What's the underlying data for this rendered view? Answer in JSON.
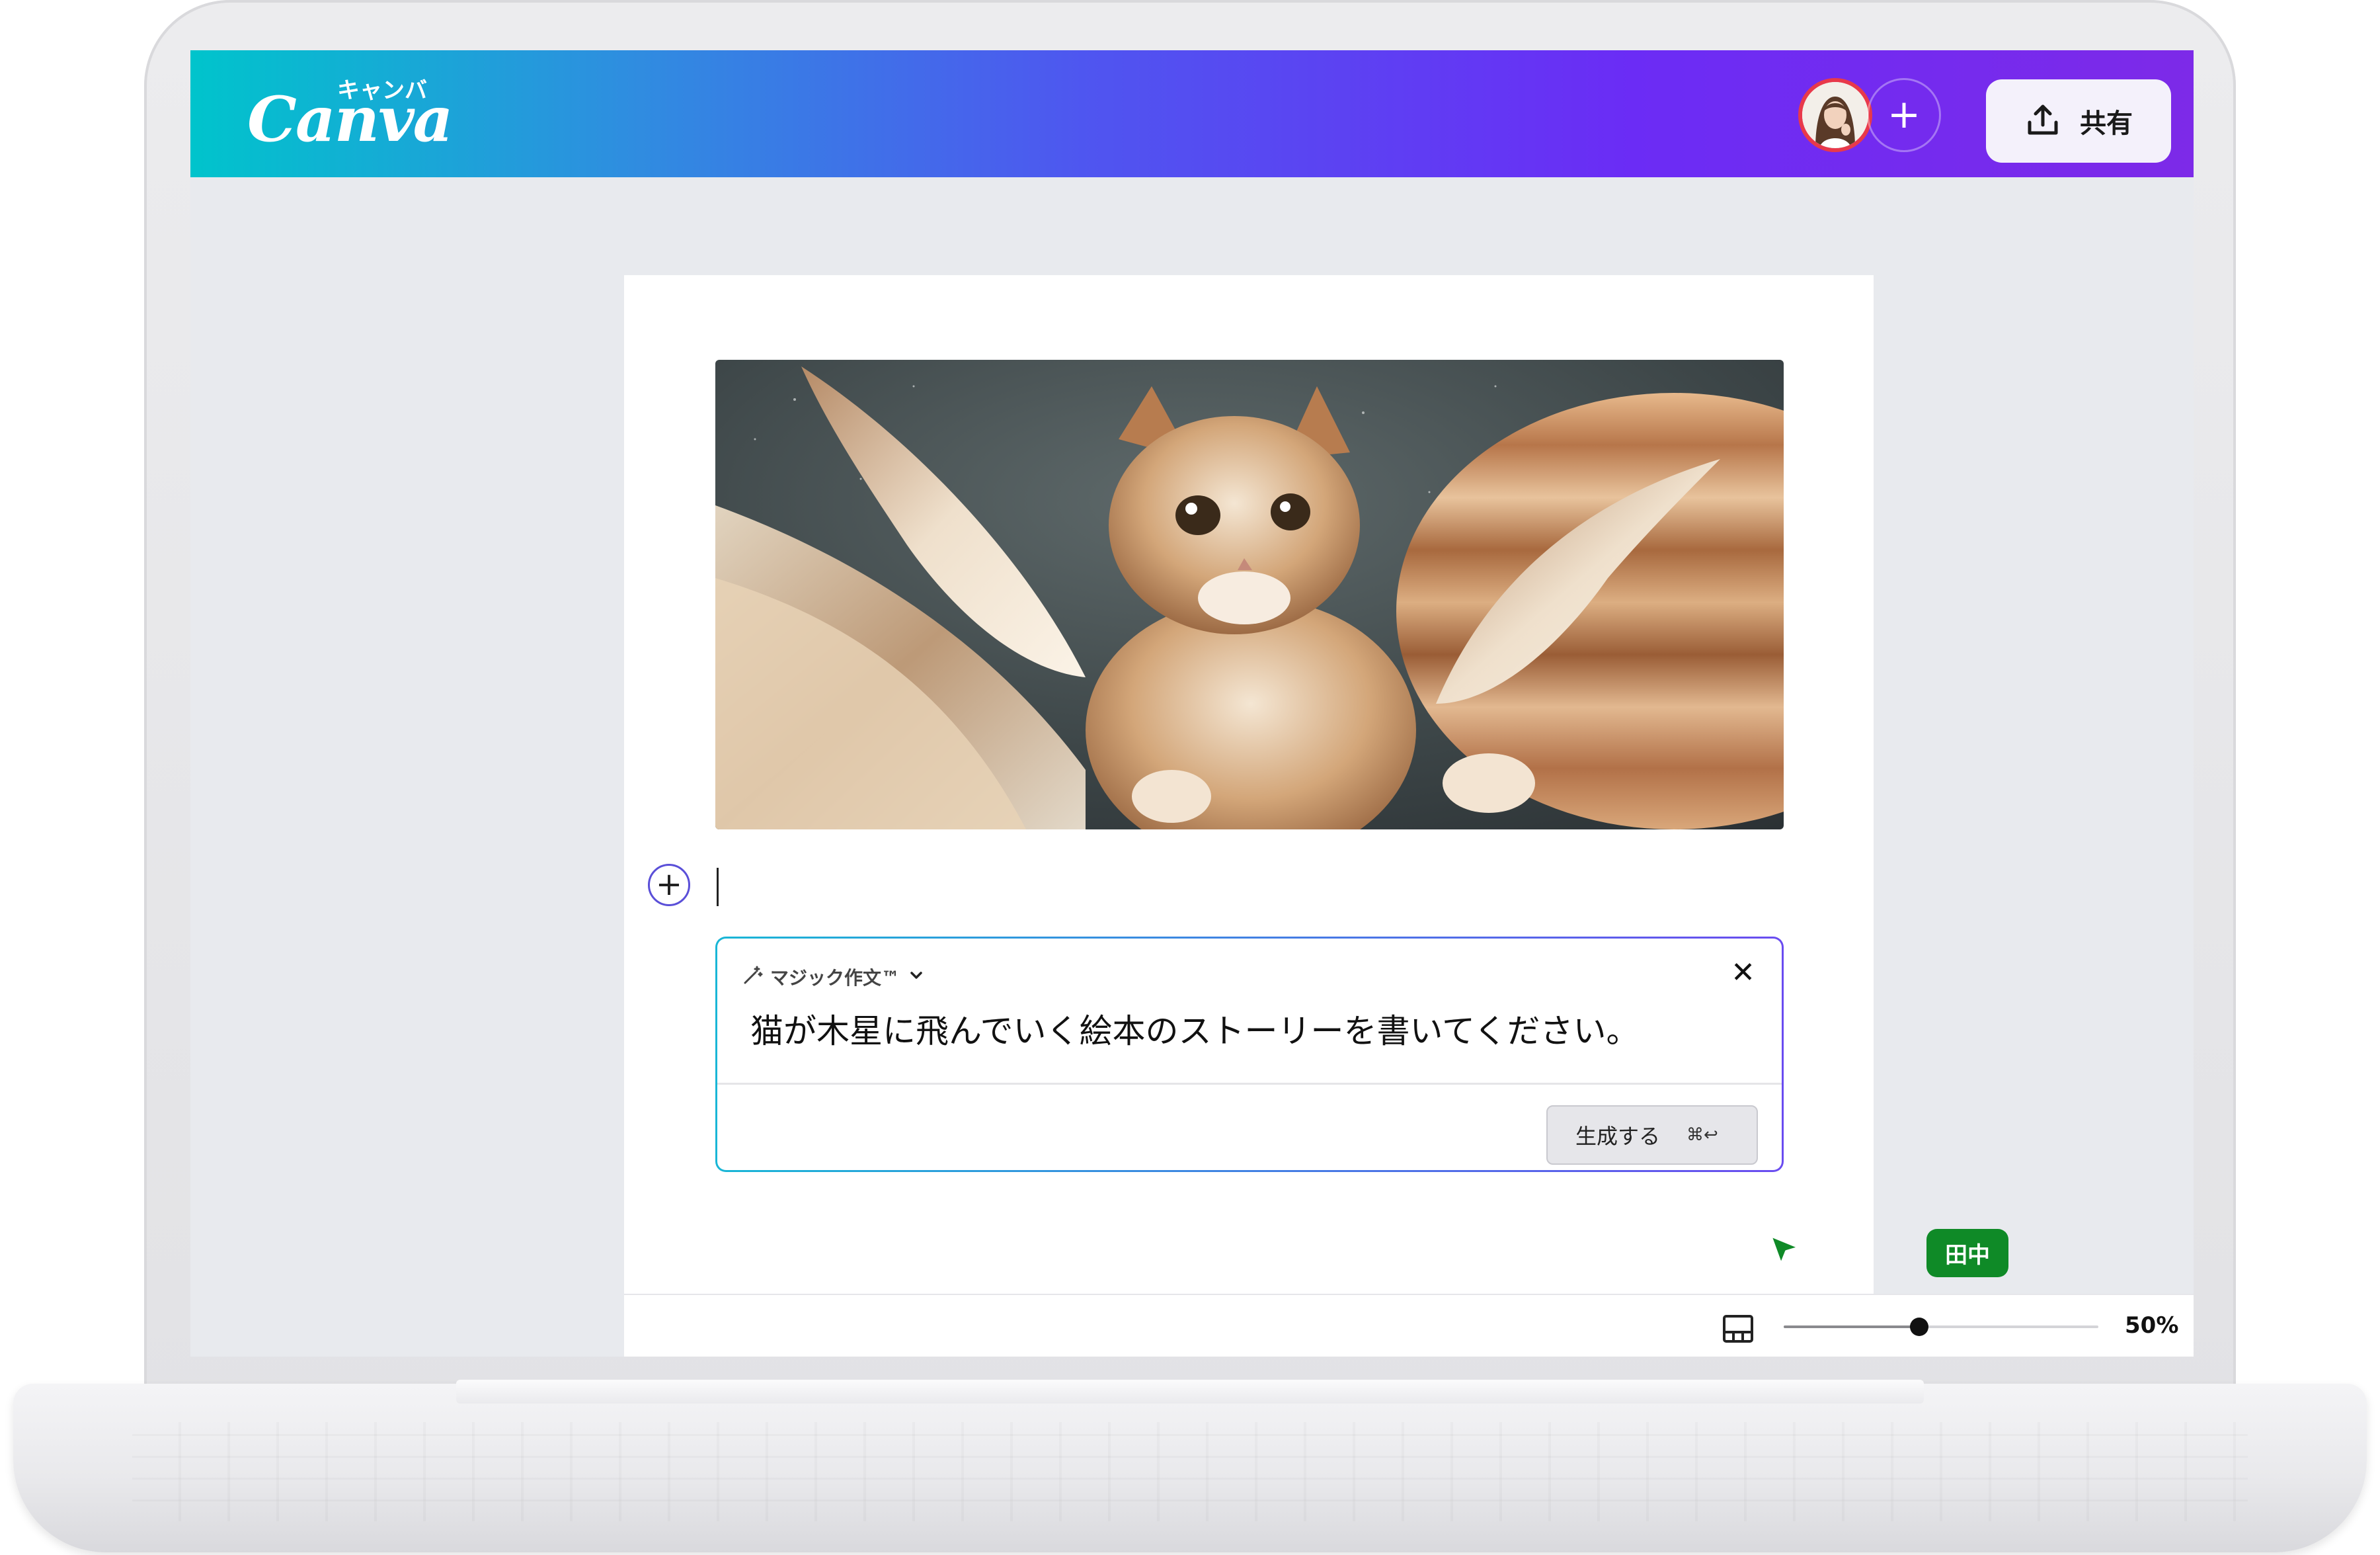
{
  "app": {
    "logo_text": "Canva",
    "logo_kana": "キャンバ"
  },
  "header": {
    "add_collaborator": "+",
    "share_label": "共有",
    "gradient": [
      "#00c4cc",
      "#4f55f0",
      "#7d2ae8"
    ]
  },
  "editor": {
    "add_block": "+",
    "magic_write": {
      "title": "マジック作文™",
      "close": "✕",
      "prompt": "猫が木星に飛んでいく絵本のストーリーを書いてください。",
      "generate_label": "生成する",
      "generate_shortcut": "⌘↩"
    },
    "collaborator_cursor": {
      "name": "田中",
      "color": "#0f8a27"
    }
  },
  "statusbar": {
    "zoom_label": "50%",
    "zoom_fraction": 0.43
  },
  "icons": [
    "magic-wand-icon",
    "chevron-down-icon",
    "close-icon",
    "share-upload-icon",
    "layout-icon",
    "plus-icon",
    "pointer-icon"
  ]
}
